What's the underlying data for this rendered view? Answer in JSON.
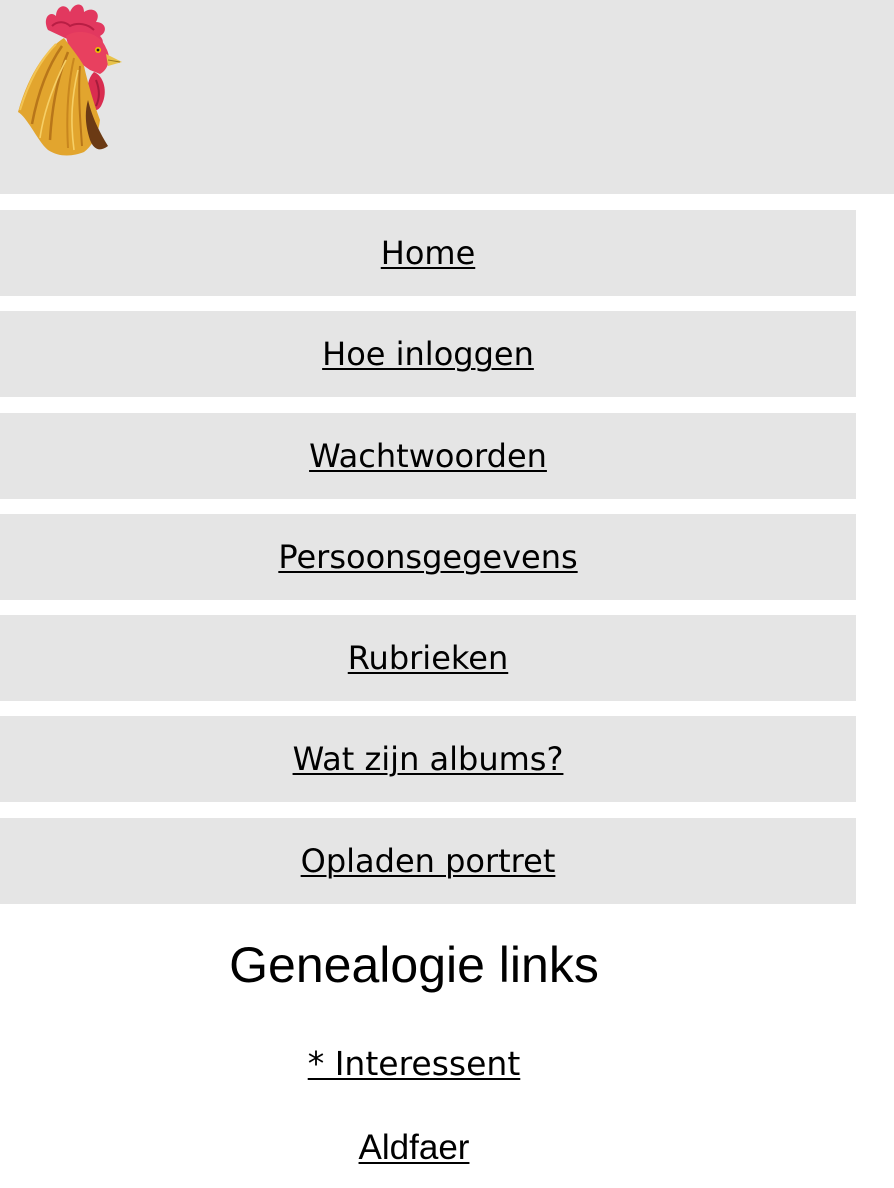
{
  "header": {
    "logo_icon": "rooster-head-icon",
    "background": "#e5e5e5"
  },
  "nav": {
    "items": [
      {
        "label": "Home"
      },
      {
        "label": "Hoe inloggen"
      },
      {
        "label": "Wachtwoorden"
      },
      {
        "label": "Persoonsgegevens"
      },
      {
        "label": "Rubrieken"
      },
      {
        "label": "Wat zijn albums?"
      },
      {
        "label": "Opladen portret"
      }
    ]
  },
  "genealogy": {
    "heading": "Genealogie links",
    "links": [
      {
        "label": "* Interessent"
      },
      {
        "label": "Aldfaer"
      }
    ]
  }
}
